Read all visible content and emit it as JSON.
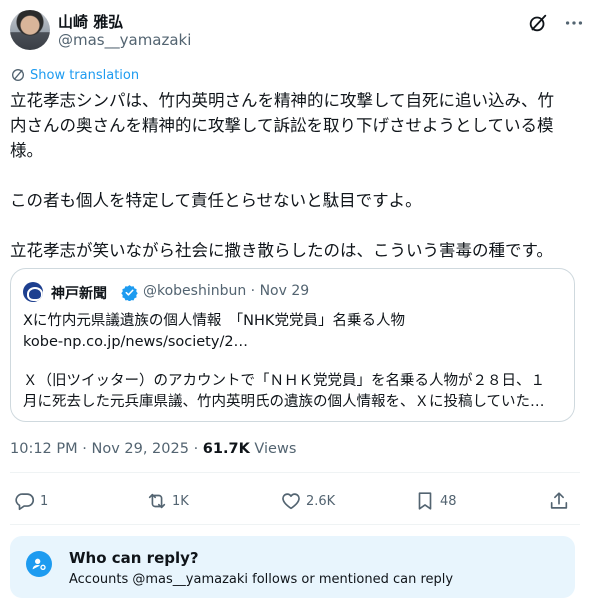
{
  "author": {
    "name": "山崎 雅弘",
    "handle": "@mas__yamazaki"
  },
  "icons": {
    "grok": "grok-icon",
    "more": "more-icon",
    "translate": "translate-icon",
    "verified": "verified-badge-icon",
    "reply": "reply-icon",
    "repost": "repost-icon",
    "like": "heart-icon",
    "bookmark": "bookmark-icon",
    "share": "share-icon",
    "who_can_reply": "person-at-icon"
  },
  "translate_label": "Show translation",
  "post_lines": [
    "立花孝志シンパは、竹内英明さんを精神的に攻撃して自死に追い込み、竹",
    "内さんの奥さんを精神的に攻撃して訴訟を取り下げさせようとしている模",
    "様。",
    "",
    "この者も個人を特定して責任とらせないと駄目ですよ。",
    "",
    "立花孝志が笑いながら社会に撒き散らしたのは、こういう害毒の種です。"
  ],
  "quote": {
    "name": "神戸新聞",
    "handle_date": "@kobeshinbun · Nov 29",
    "title": "Xに竹内元県議遺族の個人情報　「NHK党党員」名乗る人物",
    "link": "kobe-np.co.jp/news/society/2…",
    "excerpt_line1": "Ｘ（旧ツイッター）のアカウントで「ＮＨＫ党党員」を名乗る人物が２８日、１",
    "excerpt_line2": "月に死去した元兵庫県議、竹内英明氏の遺族の個人情報を、Ｘに投稿していた…"
  },
  "meta": {
    "timestamp": "10:12 PM · Nov 29, 2025 · ",
    "views_count": "61.7K",
    "views_label": " Views"
  },
  "actions": {
    "replies": "1",
    "reposts": "1K",
    "likes": "2.6K",
    "bookmarks": "48"
  },
  "who_can_reply": {
    "title": "Who can reply?",
    "subtitle": "Accounts @mas__yamazaki follows or mentioned can reply"
  },
  "colors": {
    "accent": "#1d9bf0",
    "text": "#0f1419",
    "secondary": "#536471",
    "border": "#cfd9de",
    "reply_box_bg": "#e8f5fd"
  }
}
